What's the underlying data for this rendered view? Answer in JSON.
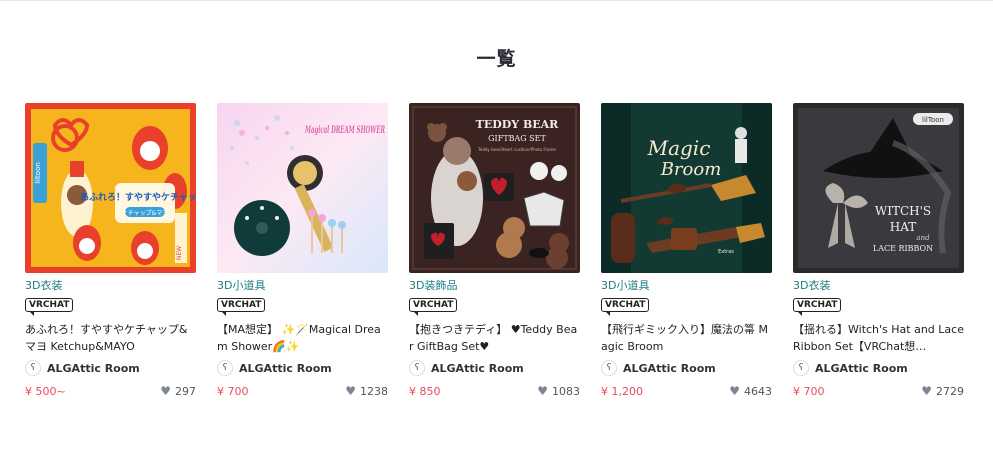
{
  "page": {
    "title": "一覧"
  },
  "items": [
    {
      "category": "3D衣装",
      "platform": "VRCHAT",
      "title": "あふれろ！すやすやケチャップ&マヨ Ketchup&MAYO",
      "shop": "ALGAttic Room",
      "price": "¥ 500~",
      "likes": "297",
      "thumb": {
        "brand": "liltoon",
        "text_main": "あふれろ！すやすやケチャップ",
        "text_tag": "ケチャップ&マヨ",
        "text_side": "NEW"
      }
    },
    {
      "category": "3D小道具",
      "platform": "VRCHAT",
      "title": "【MA想定】 ✨🪄Magical Dream Shower🌈✨",
      "shop": "ALGAttic Room",
      "price": "¥ 700",
      "likes": "1238",
      "thumb": {
        "text_main": "Magical DREAM SHOWER"
      }
    },
    {
      "category": "3D装飾品",
      "platform": "VRCHAT",
      "title": "【抱きつきテディ】 ♥Teddy Bear GiftBag Set♥",
      "shop": "ALGAttic Room",
      "price": "¥ 850",
      "likes": "1083",
      "thumb": {
        "text_main": "TEDDY BEAR",
        "text_sub": "GIFTBAG SET",
        "text_small": "Teddy bear/Heart cushion/Photo Frame"
      }
    },
    {
      "category": "3D小道具",
      "platform": "VRCHAT",
      "title": "【飛行ギミック入り】魔法の箒 Magic Broom",
      "shop": "ALGAttic Room",
      "price": "¥ 1,200",
      "likes": "4643",
      "thumb": {
        "text_main": "Magic",
        "text_sub": "Broom",
        "text_small": "Extras"
      }
    },
    {
      "category": "3D衣装",
      "platform": "VRCHAT",
      "title": "【揺れる】Witch's Hat and Lace Ribbon Set【VRChat想…",
      "shop": "ALGAttic Room",
      "price": "¥ 700",
      "likes": "2729",
      "thumb": {
        "brand": "lilToon",
        "text_main": "WITCH'S",
        "text_sub": "HAT",
        "text_small": "LACE RIBBON",
        "text_and": "and"
      }
    }
  ],
  "icons": {
    "heart": "heart-icon",
    "avatar": "shop-avatar-icon"
  },
  "colors": {
    "category": "#1a7f86",
    "price": "#e84a5f",
    "heart": "#7b8794"
  }
}
